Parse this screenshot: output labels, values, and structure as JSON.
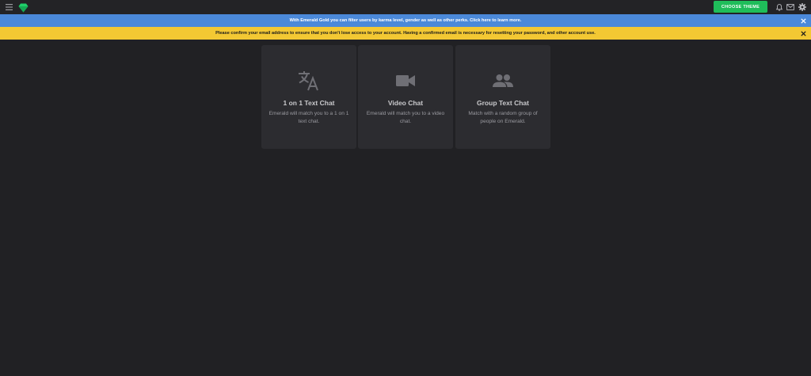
{
  "header": {
    "theme_button_label": "CHOOSE THEME",
    "icons": [
      "menu-icon",
      "emerald-logo-icon",
      "bell-icon",
      "mail-icon",
      "gear-icon"
    ],
    "accent_color": "#1fbd5a"
  },
  "banners": {
    "gold": {
      "text": "With Emerald Gold you can filter users by karma level, gender as well as other perks. Click here to learn more.",
      "color": "#4b89d9"
    },
    "email": {
      "text": "Please confirm your email address to ensure that you don't lose access to your account. Having a confirmed email is necessary for resetting your password, and other account use.",
      "color": "#f3c833"
    }
  },
  "cards": [
    {
      "title": "1 on 1 Text Chat",
      "description": "Emerald will match you to a 1 on 1 text chat.",
      "icon": "translate-icon"
    },
    {
      "title": "Video Chat",
      "description": "Emerald will match you to a video chat.",
      "icon": "video-camera-icon"
    },
    {
      "title": "Group Text Chat",
      "description": "Match with a random group of people on Emerald.",
      "icon": "group-icon"
    }
  ]
}
